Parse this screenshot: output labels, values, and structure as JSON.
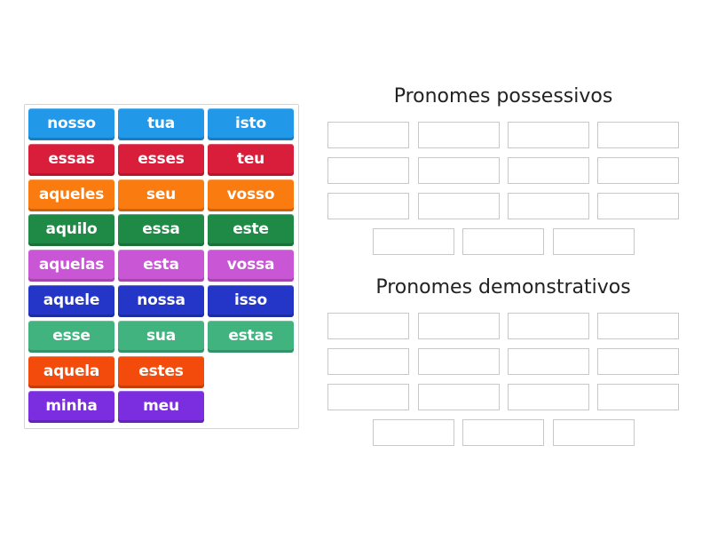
{
  "tile_colors": {
    "blue": "#2298e9",
    "red": "#d91e3b",
    "orange": "#fa7b10",
    "green": "#1f8a45",
    "magenta": "#c856d5",
    "darkblue": "#2436c8",
    "teal": "#40b37f",
    "redorange": "#f34b0c",
    "purple": "#7b2ee0"
  },
  "tiles": [
    {
      "label": "nosso",
      "color": "blue"
    },
    {
      "label": "tua",
      "color": "blue"
    },
    {
      "label": "isto",
      "color": "blue"
    },
    {
      "label": "essas",
      "color": "red"
    },
    {
      "label": "esses",
      "color": "red"
    },
    {
      "label": "teu",
      "color": "red"
    },
    {
      "label": "aqueles",
      "color": "orange"
    },
    {
      "label": "seu",
      "color": "orange"
    },
    {
      "label": "vosso",
      "color": "orange"
    },
    {
      "label": "aquilo",
      "color": "green"
    },
    {
      "label": "essa",
      "color": "green"
    },
    {
      "label": "este",
      "color": "green"
    },
    {
      "label": "aquelas",
      "color": "magenta"
    },
    {
      "label": "esta",
      "color": "magenta"
    },
    {
      "label": "vossa",
      "color": "magenta"
    },
    {
      "label": "aquele",
      "color": "darkblue"
    },
    {
      "label": "nossa",
      "color": "darkblue"
    },
    {
      "label": "isso",
      "color": "darkblue"
    },
    {
      "label": "esse",
      "color": "teal"
    },
    {
      "label": "sua",
      "color": "teal"
    },
    {
      "label": "estas",
      "color": "teal"
    },
    {
      "label": "aquela",
      "color": "redorange"
    },
    {
      "label": "estes",
      "color": "redorange"
    },
    {
      "label": "minha",
      "color": "purple"
    },
    {
      "label": "meu",
      "color": "purple"
    }
  ],
  "groups": [
    {
      "title": "Pronomes possessivos",
      "slot_count": 15
    },
    {
      "title": "Pronomes demonstrativos",
      "slot_count": 15
    }
  ]
}
